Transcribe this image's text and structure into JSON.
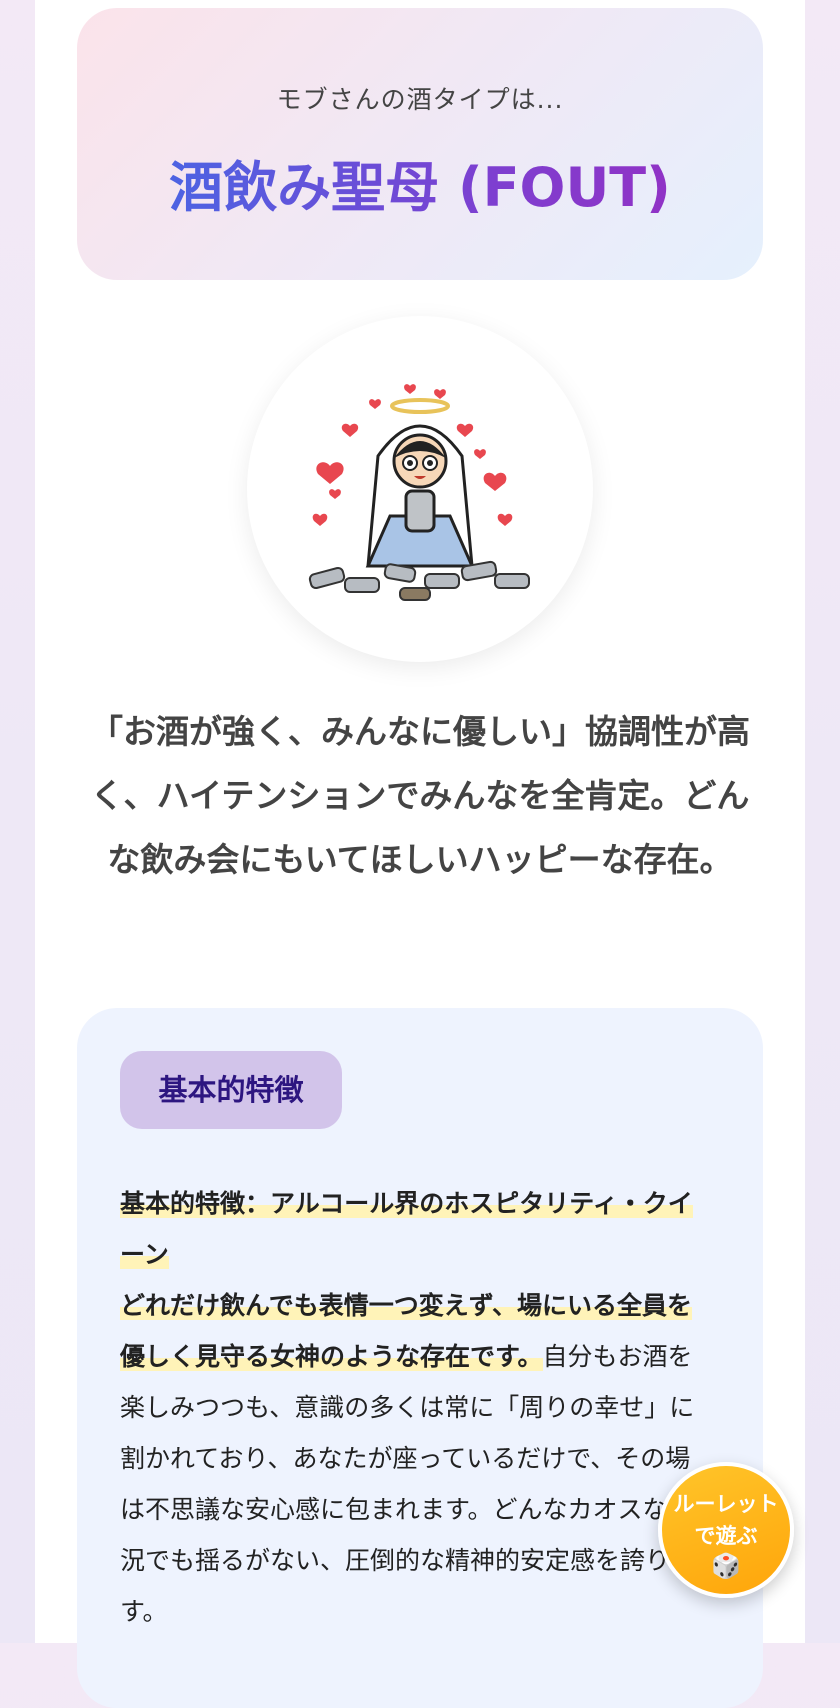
{
  "result": {
    "subtitle": "モブさんの酒タイプは...",
    "title": "酒飲み聖母 (FOUT)"
  },
  "avatar": {
    "icon": "drinking-madonna-illustration"
  },
  "lead_text": "「お酒が強く、みんなに優しい」協調性が高く、ハイテンションでみんなを全肯定。どんな飲み会にもいてほしいハッピーな存在。",
  "features": {
    "tag_label": "基本的特徴",
    "highlight_1": "基本的特徴：アルコール界のホスピタリティ・クイーン",
    "highlight_2": "どれだけ飲んでも表情一つ変えず、場にいる全員を優しく見守る女神のような存在です。",
    "body": "自分もお酒を楽しみつつも、意識の多くは常に「周りの幸せ」に割かれており、あなたが座っているだけで、その場は不思議な安心感に包まれます。どんなカオスな状況でも揺るがない、圧倒的な精神的安定感を誇ります。"
  },
  "fab": {
    "label": "ルーレットで遊ぶ",
    "icon": "🎲"
  },
  "colors": {
    "title_gradient_start": "#3f6ee8",
    "title_gradient_end": "#9a2cc0",
    "tag_bg": "#d2c4ea",
    "fab_bg": "#ffb01a"
  }
}
